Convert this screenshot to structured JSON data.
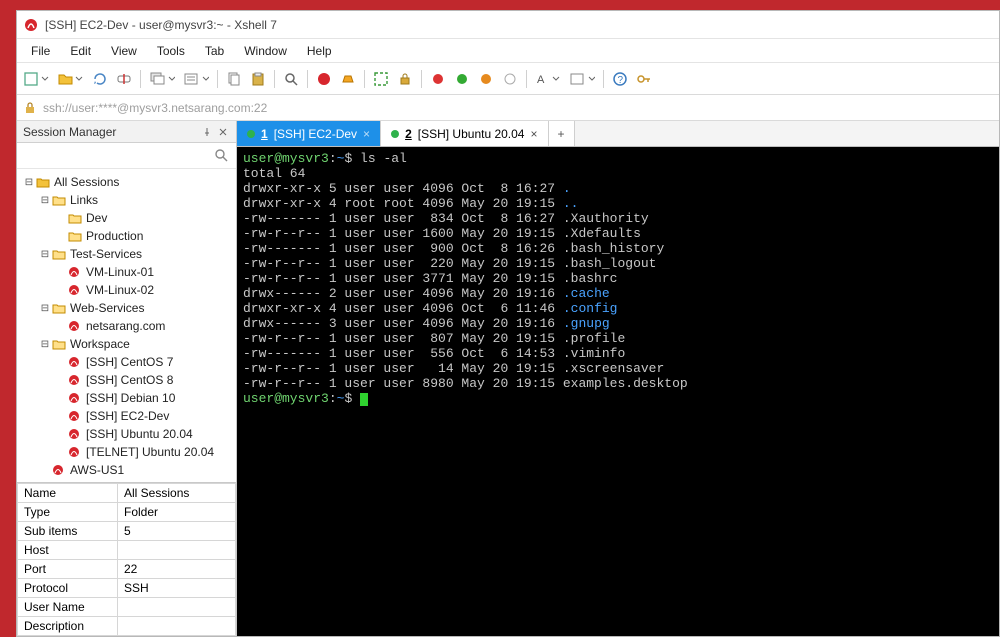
{
  "window": {
    "title": "[SSH] EC2-Dev - user@mysvr3:~ - Xshell 7"
  },
  "menubar": [
    "File",
    "Edit",
    "View",
    "Tools",
    "Tab",
    "Window",
    "Help"
  ],
  "addressbar": {
    "text": "ssh://user:****@mysvr3.netsarang.com:22"
  },
  "sidebar": {
    "header": "Session Manager",
    "tree": [
      {
        "ind": 0,
        "twisty": "-",
        "icon": "folder-root",
        "label": "All Sessions"
      },
      {
        "ind": 1,
        "twisty": "-",
        "icon": "folder",
        "label": "Links"
      },
      {
        "ind": 2,
        "twisty": "",
        "icon": "folder",
        "label": "Dev"
      },
      {
        "ind": 2,
        "twisty": "",
        "icon": "folder",
        "label": "Production"
      },
      {
        "ind": 1,
        "twisty": "-",
        "icon": "folder",
        "label": "Test-Services"
      },
      {
        "ind": 2,
        "twisty": "",
        "icon": "session",
        "label": "VM-Linux-01"
      },
      {
        "ind": 2,
        "twisty": "",
        "icon": "session",
        "label": "VM-Linux-02"
      },
      {
        "ind": 1,
        "twisty": "-",
        "icon": "folder",
        "label": "Web-Services"
      },
      {
        "ind": 2,
        "twisty": "",
        "icon": "session",
        "label": "netsarang.com"
      },
      {
        "ind": 1,
        "twisty": "-",
        "icon": "folder",
        "label": "Workspace"
      },
      {
        "ind": 2,
        "twisty": "",
        "icon": "session",
        "label": "[SSH] CentOS 7"
      },
      {
        "ind": 2,
        "twisty": "",
        "icon": "session",
        "label": "[SSH] CentOS 8"
      },
      {
        "ind": 2,
        "twisty": "",
        "icon": "session",
        "label": "[SSH] Debian 10"
      },
      {
        "ind": 2,
        "twisty": "",
        "icon": "session",
        "label": "[SSH] EC2-Dev"
      },
      {
        "ind": 2,
        "twisty": "",
        "icon": "session",
        "label": "[SSH] Ubuntu 20.04"
      },
      {
        "ind": 2,
        "twisty": "",
        "icon": "session",
        "label": "[TELNET] Ubuntu 20.04"
      },
      {
        "ind": 1,
        "twisty": "",
        "icon": "session",
        "label": "AWS-US1"
      }
    ],
    "props": [
      {
        "k": "Name",
        "v": "All Sessions"
      },
      {
        "k": "Type",
        "v": "Folder"
      },
      {
        "k": "Sub items",
        "v": "5"
      },
      {
        "k": "Host",
        "v": ""
      },
      {
        "k": "Port",
        "v": "22"
      },
      {
        "k": "Protocol",
        "v": "SSH"
      },
      {
        "k": "User Name",
        "v": ""
      },
      {
        "k": "Description",
        "v": ""
      }
    ]
  },
  "tabs": [
    {
      "num": "1",
      "label": "[SSH] EC2-Dev",
      "active": true
    },
    {
      "num": "2",
      "label": "[SSH] Ubuntu 20.04",
      "active": false
    }
  ],
  "terminal": {
    "prompt_user": "user@mysvr3",
    "prompt_path": "~",
    "command": "ls -al",
    "lines": [
      {
        "t": "total 64"
      },
      {
        "t": "drwxr-xr-x 5 user user 4096 Oct  8 16:27 ",
        "tail": ".",
        "cls": "blu"
      },
      {
        "t": "drwxr-xr-x 4 root root 4096 May 20 19:15 ",
        "tail": "..",
        "cls": "blu"
      },
      {
        "t": "-rw------- 1 user user  834 Oct  8 16:27 .Xauthority"
      },
      {
        "t": "-rw-r--r-- 1 user user 1600 May 20 19:15 .Xdefaults"
      },
      {
        "t": "-rw------- 1 user user  900 Oct  8 16:26 .bash_history"
      },
      {
        "t": "-rw-r--r-- 1 user user  220 May 20 19:15 .bash_logout"
      },
      {
        "t": "-rw-r--r-- 1 user user 3771 May 20 19:15 .bashrc"
      },
      {
        "t": "drwx------ 2 user user 4096 May 20 19:16 ",
        "tail": ".cache",
        "cls": "blu"
      },
      {
        "t": "drwxr-xr-x 4 user user 4096 Oct  6 11:46 ",
        "tail": ".config",
        "cls": "blu"
      },
      {
        "t": "drwx------ 3 user user 4096 May 20 19:16 ",
        "tail": ".gnupg",
        "cls": "blu"
      },
      {
        "t": "-rw-r--r-- 1 user user  807 May 20 19:15 .profile"
      },
      {
        "t": "-rw------- 1 user user  556 Oct  6 14:53 .viminfo"
      },
      {
        "t": "-rw-r--r-- 1 user user   14 May 20 19:15 .xscreensaver"
      },
      {
        "t": "-rw-r--r-- 1 user user 8980 May 20 19:15 examples.desktop"
      }
    ]
  }
}
